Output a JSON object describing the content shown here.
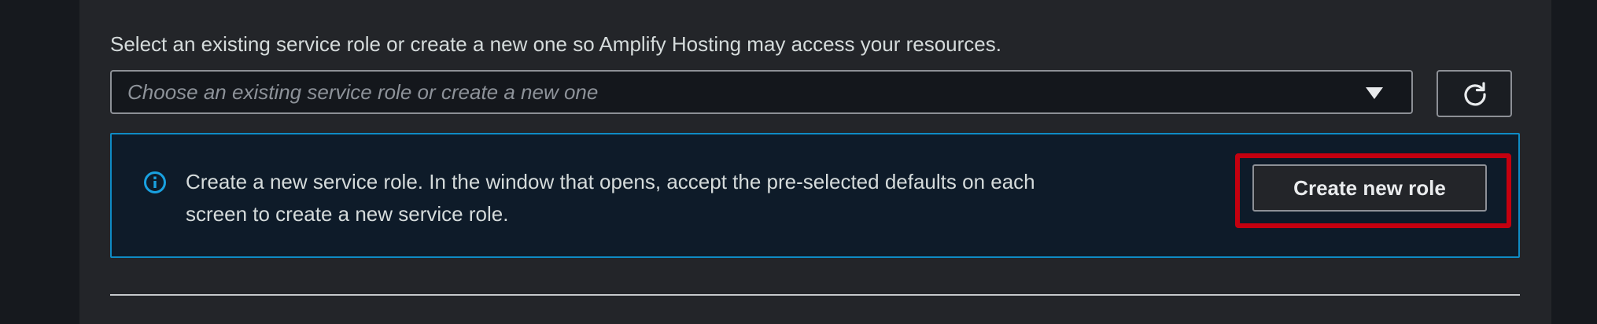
{
  "service_role": {
    "description": "Select an existing service role or create a new one so Amplify Hosting may access your resources.",
    "select_placeholder": "Choose an existing service role or create a new one",
    "caret_icon": "caret-down-icon",
    "refresh_icon": "refresh-icon"
  },
  "info_alert": {
    "icon": "info-icon",
    "message": "Create a new service role. In the window that opens, accept the pre-selected defaults on each screen to create a new service role.",
    "create_button_label": "Create new role"
  },
  "colors": {
    "panel_background": "#232529",
    "page_background": "#15181d",
    "info_border": "#0f8bc4",
    "info_background": "#0e1b29",
    "highlight": "#c4000f",
    "text": "#d5dbdb"
  }
}
